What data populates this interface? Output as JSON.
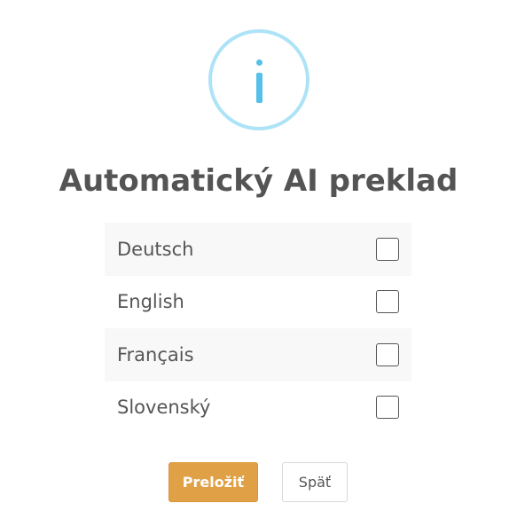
{
  "dialog": {
    "icon": "info-icon",
    "title": "Automatický AI preklad",
    "languages": [
      {
        "label": "Deutsch",
        "checked": false
      },
      {
        "label": "English",
        "checked": false
      },
      {
        "label": "Français",
        "checked": false
      },
      {
        "label": "Slovenský",
        "checked": false
      }
    ],
    "buttons": {
      "confirm": "Preložiť",
      "back": "Späť"
    },
    "colors": {
      "info_ring": "#ade3f7",
      "info_glyph": "#55c0e8",
      "confirm_bg": "#e0a045"
    }
  }
}
